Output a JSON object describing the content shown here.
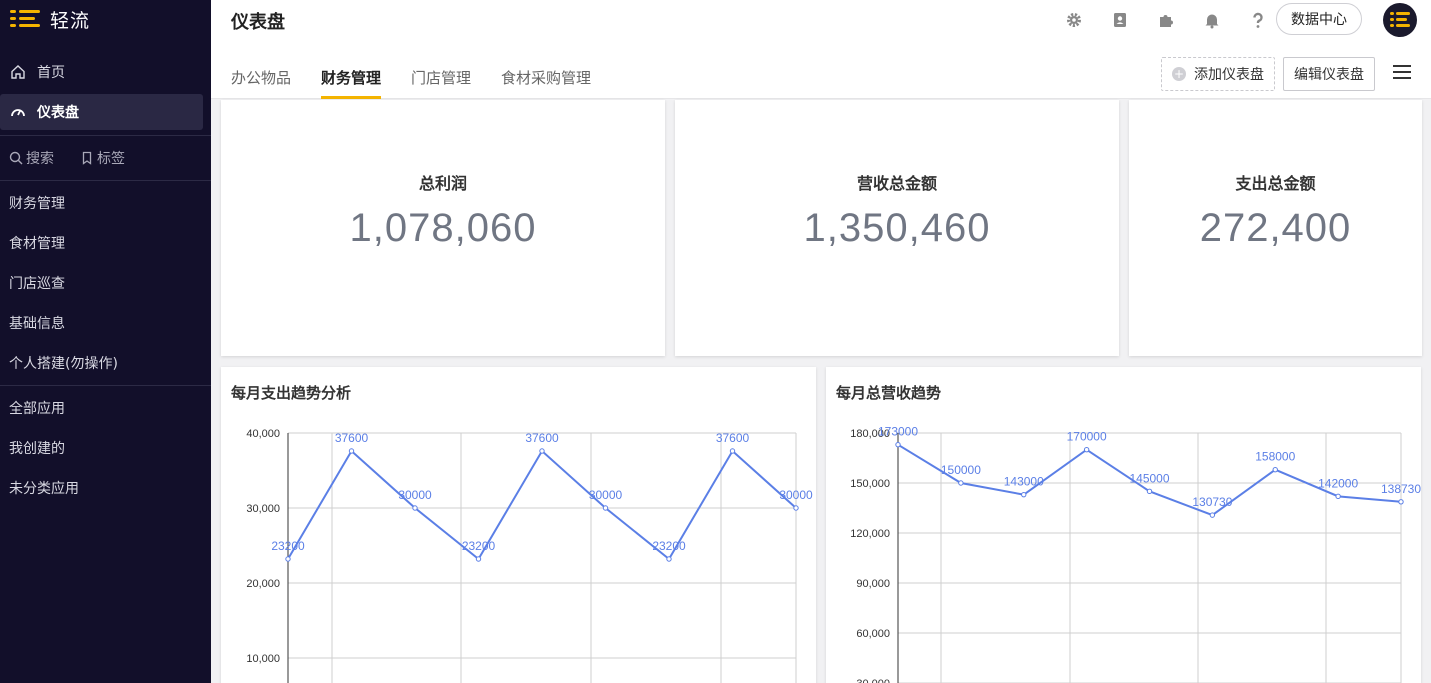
{
  "brand": {
    "name": "轻流"
  },
  "sidebar": {
    "nav": [
      {
        "label": "首页",
        "icon": "home-icon"
      },
      {
        "label": "仪表盘",
        "icon": "dashboard-icon",
        "active": true
      }
    ],
    "search_label": "搜索",
    "tag_label": "标签",
    "groups": [
      "财务管理",
      "食材管理",
      "门店巡查",
      "基础信息",
      "个人搭建(勿操作)"
    ],
    "apps": [
      "全部应用",
      "我创建的",
      "未分类应用"
    ]
  },
  "header": {
    "title": "仪表盘",
    "icons": [
      "gear-icon",
      "contacts-icon",
      "puzzle-icon",
      "bell-icon",
      "help-icon"
    ],
    "data_center": "数据中心",
    "tabs": [
      "办公物品",
      "财务管理",
      "门店管理",
      "食材采购管理"
    ],
    "active_tab": 1,
    "add_dashboard": "添加仪表盘",
    "edit_dashboard": "编辑仪表盘"
  },
  "stats": [
    {
      "title": "总利润",
      "value": "1,078,060"
    },
    {
      "title": "营收总金额",
      "value": "1,350,460"
    },
    {
      "title": "支出总金额",
      "value": "272,400"
    }
  ],
  "colors": {
    "accent": "#f4b400",
    "sidebar": "#120f2a",
    "line": "#5b7fe6"
  },
  "chart_data": [
    {
      "type": "line",
      "title": "每月支出趋势分析",
      "values": [
        23200,
        37600,
        30000,
        23200,
        37600,
        30000,
        23200,
        37600,
        30000
      ],
      "labels": [
        "23200",
        "37600",
        "30000",
        "23200",
        "37600",
        "30000",
        "23200",
        "37600",
        "30000"
      ],
      "yticks": [
        "40,000",
        "30,000",
        "20,000",
        "10,000"
      ],
      "yticks_values": [
        40000,
        30000,
        20000,
        10000
      ],
      "ylim": [
        0,
        40000
      ],
      "grid": true
    },
    {
      "type": "line",
      "title": "每月总营收趋势",
      "values": [
        173000,
        150000,
        143000,
        170000,
        145000,
        130730,
        158000,
        142000,
        138730
      ],
      "labels": [
        "173000",
        "150000",
        "143000",
        "170000",
        "145000",
        "130730",
        "158000",
        "142000",
        "138730"
      ],
      "yticks": [
        "180,000",
        "150,000",
        "120,000",
        "90,000",
        "60,000",
        "30,000"
      ],
      "yticks_values": [
        180000,
        150000,
        120000,
        90000,
        60000,
        30000
      ],
      "ylim": [
        0,
        180000
      ],
      "grid": true
    }
  ]
}
